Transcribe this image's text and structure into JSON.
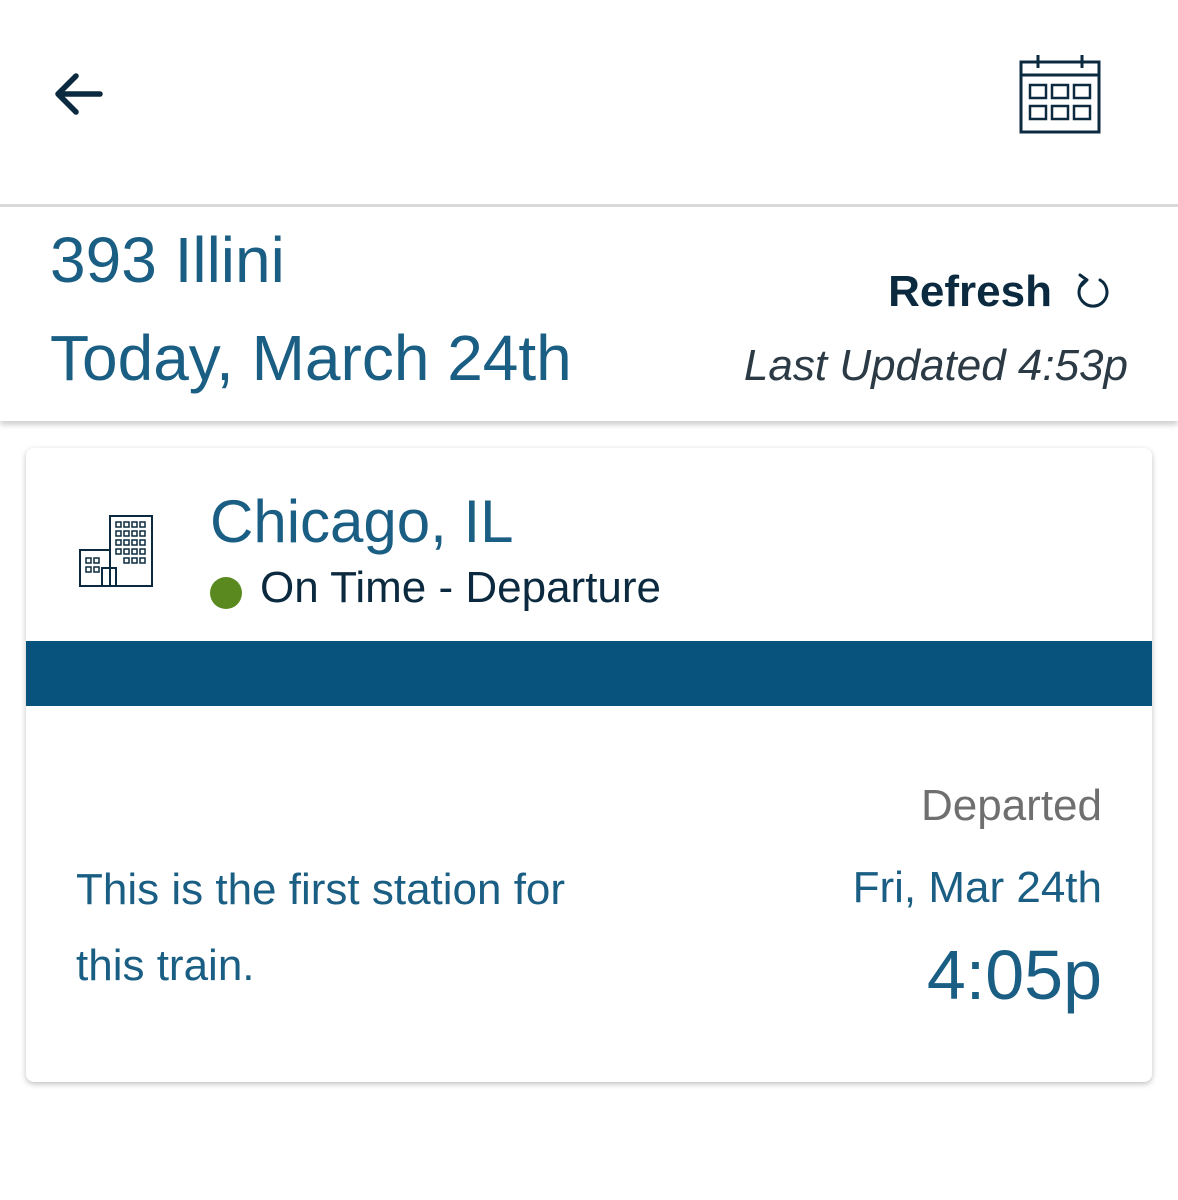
{
  "toolbar": {
    "back_icon": "arrow-left-icon",
    "calendar_icon": "calendar-icon"
  },
  "train": {
    "name": "393 Illini",
    "date": "Today, March 24th"
  },
  "refresh": {
    "label": "Refresh",
    "icon": "refresh-icon",
    "last_updated": "Last Updated 4:53p"
  },
  "stop": {
    "station_icon": "building-icon",
    "station_name": "Chicago, IL",
    "status": "On Time - Departure",
    "status_color": "#5a8a1f",
    "bar_color": "#07537e",
    "note": "This is the first station for this train.",
    "departed_label": "Departed",
    "departed_date": "Fri, Mar 24th",
    "departed_time": "4:05p"
  },
  "colors": {
    "primary_text": "#1a5e84",
    "dark_text": "#0b2a3f",
    "muted_text": "#6f6f6f"
  }
}
